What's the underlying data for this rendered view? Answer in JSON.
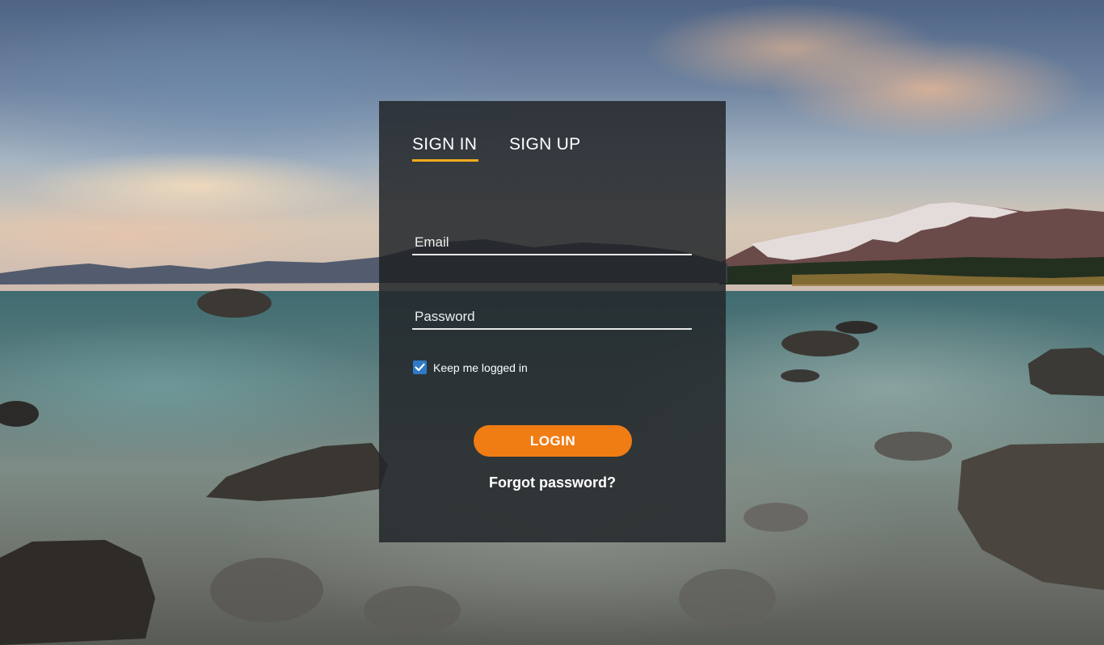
{
  "tabs": [
    {
      "label": "SIGN IN",
      "active": true
    },
    {
      "label": "SIGN UP",
      "active": false
    }
  ],
  "form": {
    "email_placeholder": "Email",
    "email_value": "",
    "password_placeholder": "Password",
    "password_value": "",
    "remember_label": "Keep me logged in",
    "remember_checked": true,
    "login_label": "LOGIN",
    "forgot_label": "Forgot password?"
  },
  "colors": {
    "accent_underline": "#f0ac1c",
    "login_button": "#f07c14",
    "checkbox": "#2f79c5",
    "card_background": "#23262a"
  },
  "icons": {
    "checkbox_mark": "checkmark-icon"
  }
}
